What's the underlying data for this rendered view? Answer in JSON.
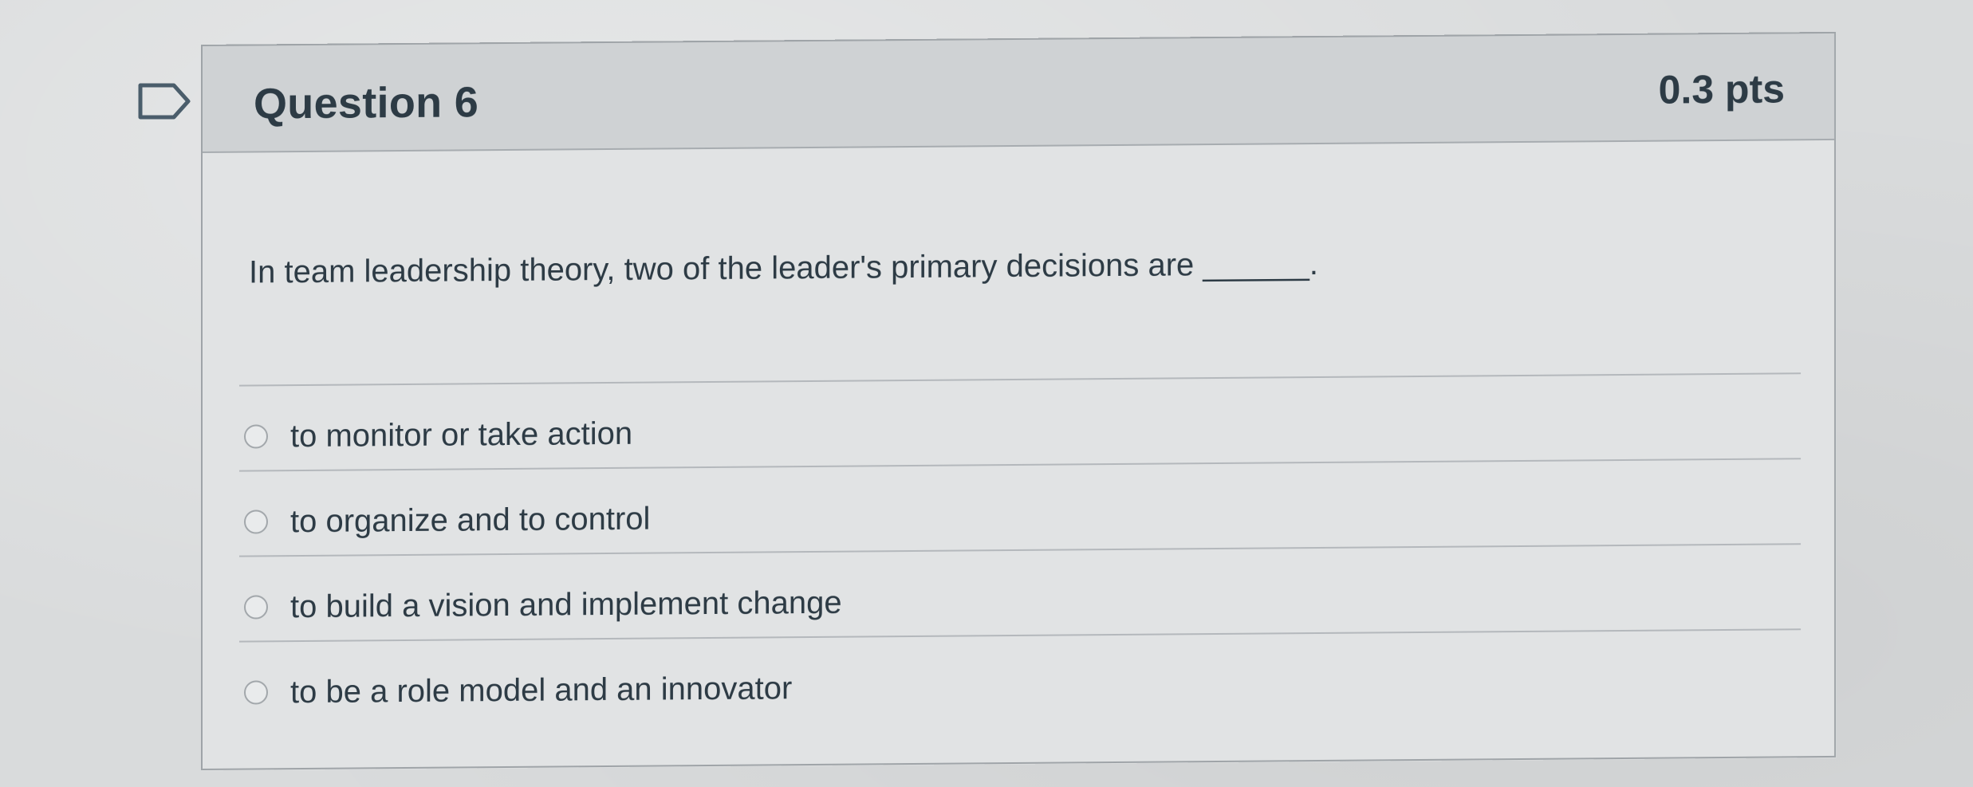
{
  "quiz": {
    "question": {
      "title": "Question 6",
      "points": "0.3 pts",
      "prompt": "In team leadership theory, two of the leader's primary decisions are ______.",
      "answers": [
        {
          "label": "to monitor or take action",
          "selected": false
        },
        {
          "label": "to organize and to control",
          "selected": false
        },
        {
          "label": "to build a vision and implement change",
          "selected": false
        },
        {
          "label": "to be a role model and an innovator",
          "selected": false
        }
      ],
      "flag_icon": "flag-icon"
    }
  }
}
